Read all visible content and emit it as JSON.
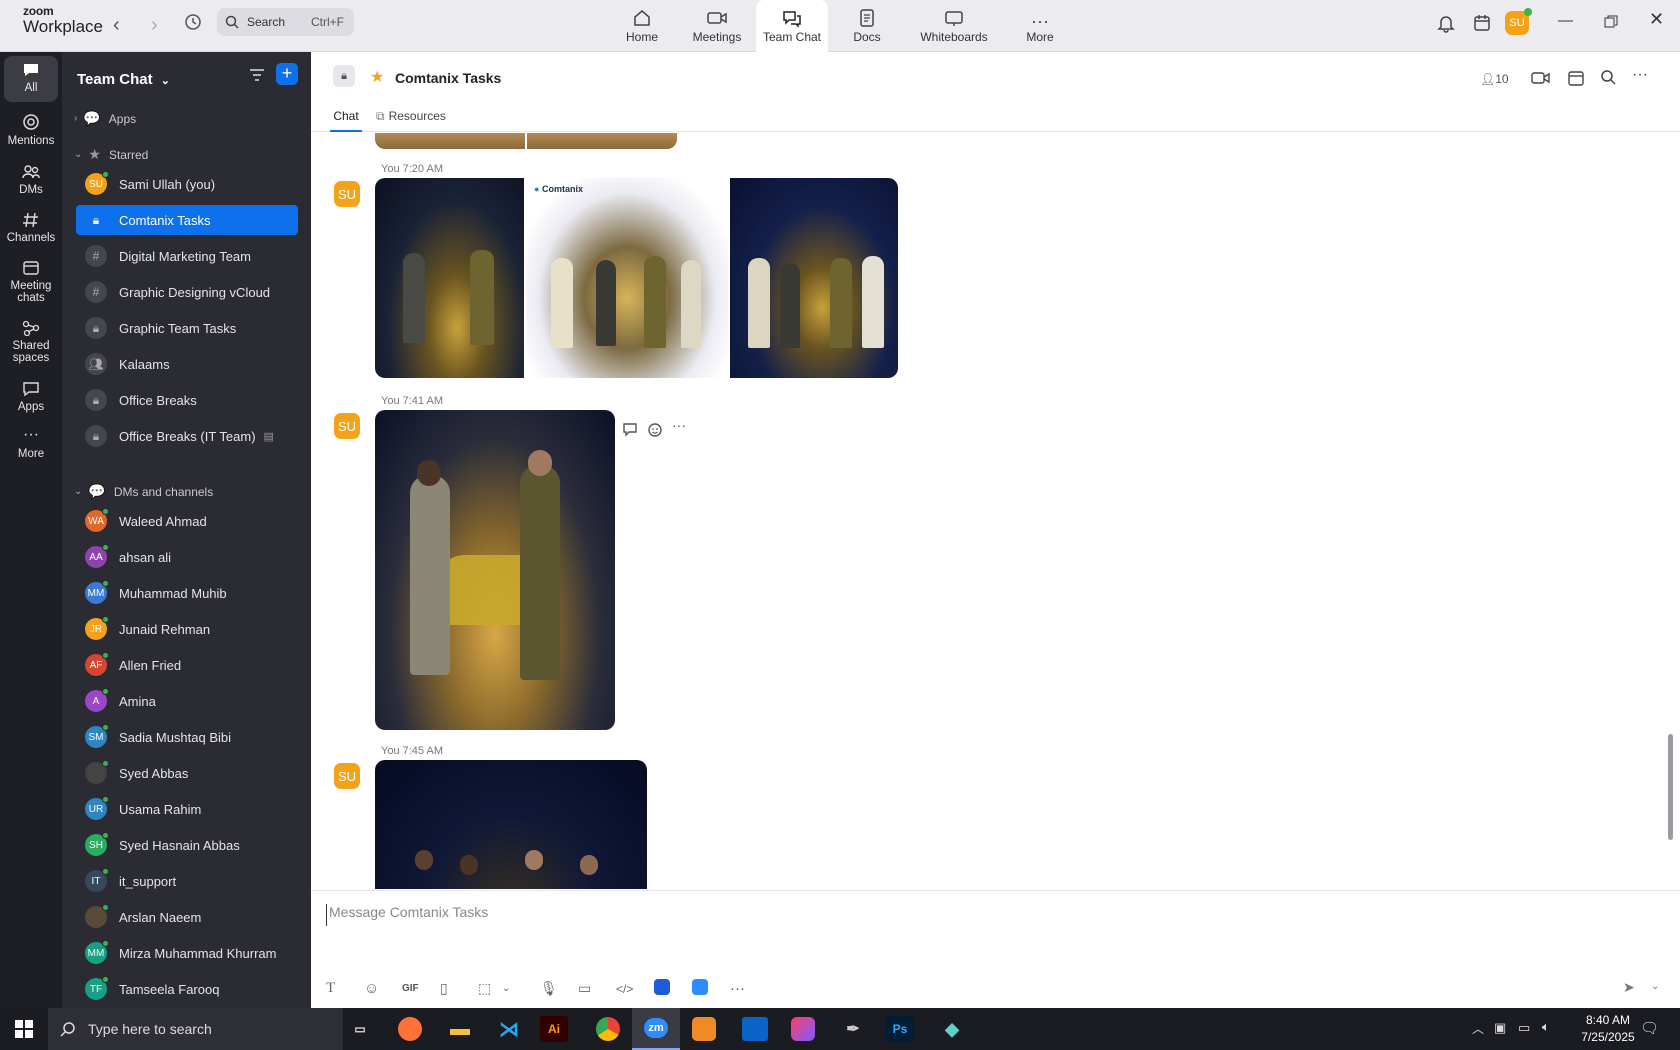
{
  "app": {
    "logo_top": "zoom",
    "logo_bottom": "Workplace"
  },
  "search": {
    "label": "Search",
    "shortcut": "Ctrl+F"
  },
  "top_tabs": [
    {
      "label": "Home"
    },
    {
      "label": "Meetings"
    },
    {
      "label": "Team Chat"
    },
    {
      "label": "Docs"
    },
    {
      "label": "Whiteboards"
    },
    {
      "label": "More"
    }
  ],
  "user_avatar": "SU",
  "rail": [
    {
      "label": "All"
    },
    {
      "label": "Mentions"
    },
    {
      "label": "DMs"
    },
    {
      "label": "Channels"
    },
    {
      "label": "Meeting chats"
    },
    {
      "label": "Shared spaces"
    },
    {
      "label": "Apps"
    },
    {
      "label": "More"
    }
  ],
  "sidebar": {
    "title": "Team Chat",
    "apps_label": "Apps",
    "starred_label": "Starred",
    "starred": [
      {
        "label": "Sami Ullah (you)",
        "initials": "SU",
        "color": "#f4a21a"
      },
      {
        "label": "Comtanix Tasks",
        "icon": "lock"
      },
      {
        "label": "Digital Marketing Team",
        "icon": "hash"
      },
      {
        "label": "Graphic Designing vCloud",
        "icon": "hash"
      },
      {
        "label": "Graphic Team Tasks",
        "icon": "lock"
      },
      {
        "label": "Kalaams",
        "icon": "group"
      },
      {
        "label": "Office Breaks",
        "icon": "lock"
      },
      {
        "label": "Office Breaks (IT Team)",
        "icon": "lock"
      }
    ],
    "dms_label": "DMs and channels",
    "dms": [
      {
        "label": "Waleed Ahmad",
        "initials": "WA",
        "color": "#e2672a"
      },
      {
        "label": "ahsan ali",
        "initials": "AA",
        "color": "#8e44ad"
      },
      {
        "label": "Muhammad Muhib",
        "initials": "MM",
        "color": "#3a7bd5"
      },
      {
        "label": "Junaid Rehman",
        "initials": "JR",
        "color": "#f4a21a"
      },
      {
        "label": "Allen Fried",
        "initials": "AF",
        "color": "#d6452f"
      },
      {
        "label": "Amina",
        "initials": "A",
        "color": "#9b45c9"
      },
      {
        "label": "Sadia Mushtaq Bibi",
        "initials": "SM",
        "color": "#2e86c1"
      },
      {
        "label": "Syed Abbas",
        "initials": "",
        "color": "#444"
      },
      {
        "label": "Usama Rahim",
        "initials": "UR",
        "color": "#2e86c1"
      },
      {
        "label": "Syed Hasnain Abbas",
        "initials": "SH",
        "color": "#27ae60"
      },
      {
        "label": "it_support",
        "initials": "IT",
        "color": "#34495e"
      },
      {
        "label": "Arslan Naeem",
        "initials": "",
        "color": "#5a4a3a"
      },
      {
        "label": "Mirza Muhammad Khurram",
        "initials": "MM",
        "color": "#16a085"
      },
      {
        "label": "Tamseela Farooq",
        "initials": "TF",
        "color": "#16a085"
      }
    ]
  },
  "channel": {
    "name": "Comtanix Tasks",
    "members": "10",
    "tabs": [
      "Chat",
      "Resources"
    ]
  },
  "messages": [
    {
      "time": "You 7:20 AM",
      "sender": "SU"
    },
    {
      "time": "You 7:41 AM",
      "sender": "SU"
    },
    {
      "time": "You 7:45 AM",
      "sender": "SU"
    }
  ],
  "photo_brand": "Comtanix",
  "compose": {
    "placeholder": "Message Comtanix Tasks",
    "gif": "GIF"
  },
  "taskbar": {
    "search": "Type here to search",
    "time": "8:40 AM",
    "date": "7/25/2025",
    "ai": "Ai",
    "ps": "Ps",
    "zm": "zm"
  }
}
